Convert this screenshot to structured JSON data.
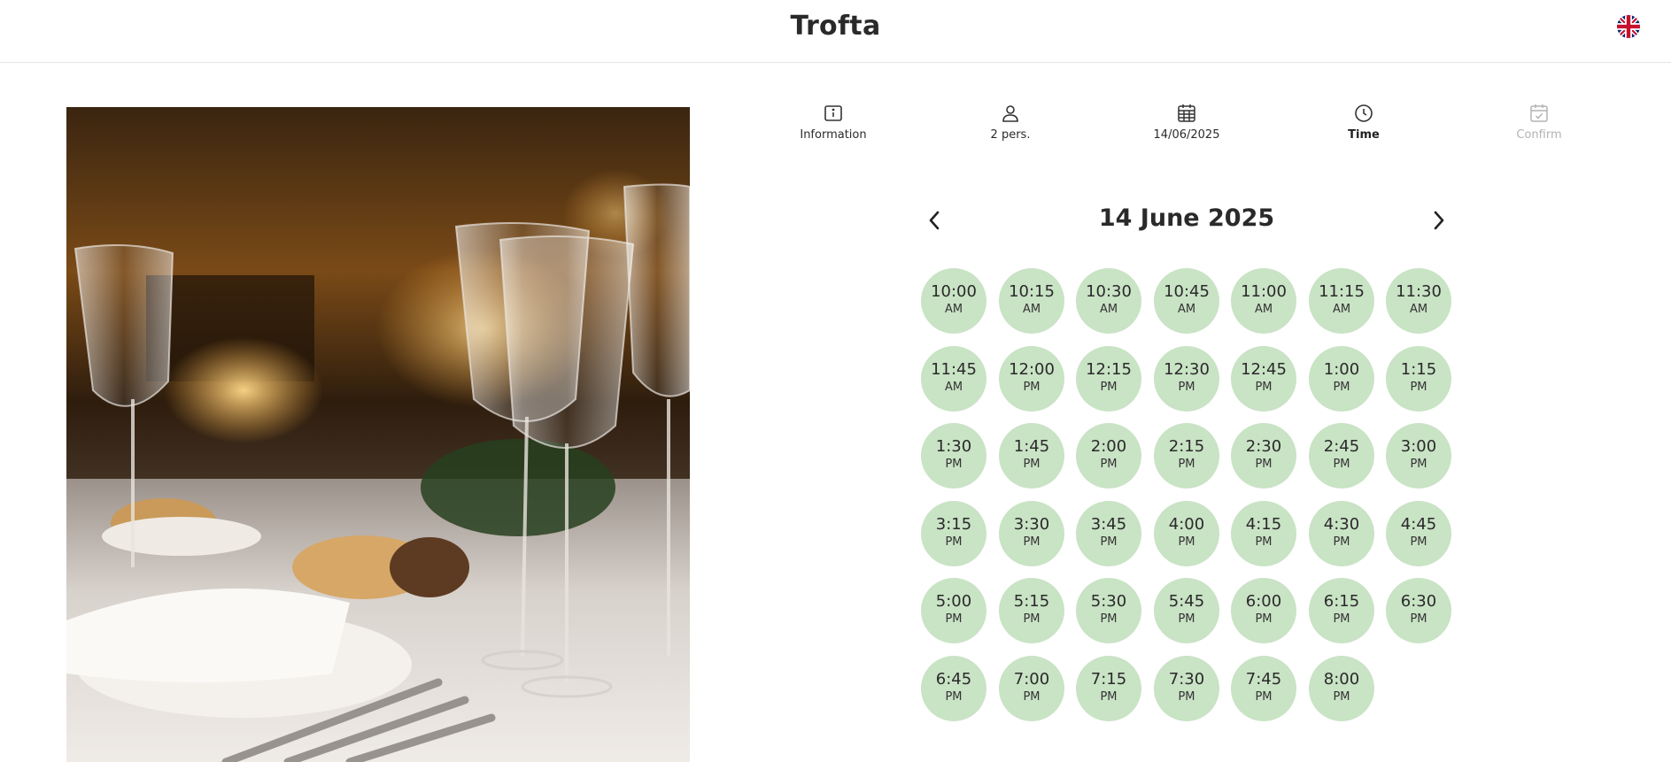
{
  "header": {
    "brand": "Trofta",
    "language_icon": "uk-flag-icon"
  },
  "steps": [
    {
      "label": "Information",
      "icon": "info-icon",
      "state": "done"
    },
    {
      "label": "2 pers.",
      "icon": "person-icon",
      "state": "done"
    },
    {
      "label": "14/06/2025",
      "icon": "calendar-icon",
      "state": "done"
    },
    {
      "label": "Time",
      "icon": "clock-icon",
      "state": "active"
    },
    {
      "label": "Confirm",
      "icon": "calendar-check-icon",
      "state": "disabled"
    }
  ],
  "date_nav": {
    "title": "14 June 2025",
    "prev_icon": "chevron-left-icon",
    "next_icon": "chevron-right-icon"
  },
  "colors": {
    "slot_bg": "#c9e3c5",
    "text": "#2a2a2a",
    "disabled": "#b3b3b3"
  },
  "slots": [
    {
      "time": "10:00",
      "period": "AM"
    },
    {
      "time": "10:15",
      "period": "AM"
    },
    {
      "time": "10:30",
      "period": "AM"
    },
    {
      "time": "10:45",
      "period": "AM"
    },
    {
      "time": "11:00",
      "period": "AM"
    },
    {
      "time": "11:15",
      "period": "AM"
    },
    {
      "time": "11:30",
      "period": "AM"
    },
    {
      "time": "11:45",
      "period": "AM"
    },
    {
      "time": "12:00",
      "period": "PM"
    },
    {
      "time": "12:15",
      "period": "PM"
    },
    {
      "time": "12:30",
      "period": "PM"
    },
    {
      "time": "12:45",
      "period": "PM"
    },
    {
      "time": "1:00",
      "period": "PM"
    },
    {
      "time": "1:15",
      "period": "PM"
    },
    {
      "time": "1:30",
      "period": "PM"
    },
    {
      "time": "1:45",
      "period": "PM"
    },
    {
      "time": "2:00",
      "period": "PM"
    },
    {
      "time": "2:15",
      "period": "PM"
    },
    {
      "time": "2:30",
      "period": "PM"
    },
    {
      "time": "2:45",
      "period": "PM"
    },
    {
      "time": "3:00",
      "period": "PM"
    },
    {
      "time": "3:15",
      "period": "PM"
    },
    {
      "time": "3:30",
      "period": "PM"
    },
    {
      "time": "3:45",
      "period": "PM"
    },
    {
      "time": "4:00",
      "period": "PM"
    },
    {
      "time": "4:15",
      "period": "PM"
    },
    {
      "time": "4:30",
      "period": "PM"
    },
    {
      "time": "4:45",
      "period": "PM"
    },
    {
      "time": "5:00",
      "period": "PM"
    },
    {
      "time": "5:15",
      "period": "PM"
    },
    {
      "time": "5:30",
      "period": "PM"
    },
    {
      "time": "5:45",
      "period": "PM"
    },
    {
      "time": "6:00",
      "period": "PM"
    },
    {
      "time": "6:15",
      "period": "PM"
    },
    {
      "time": "6:30",
      "period": "PM"
    },
    {
      "time": "6:45",
      "period": "PM"
    },
    {
      "time": "7:00",
      "period": "PM"
    },
    {
      "time": "7:15",
      "period": "PM"
    },
    {
      "time": "7:30",
      "period": "PM"
    },
    {
      "time": "7:45",
      "period": "PM"
    },
    {
      "time": "8:00",
      "period": "PM"
    }
  ]
}
